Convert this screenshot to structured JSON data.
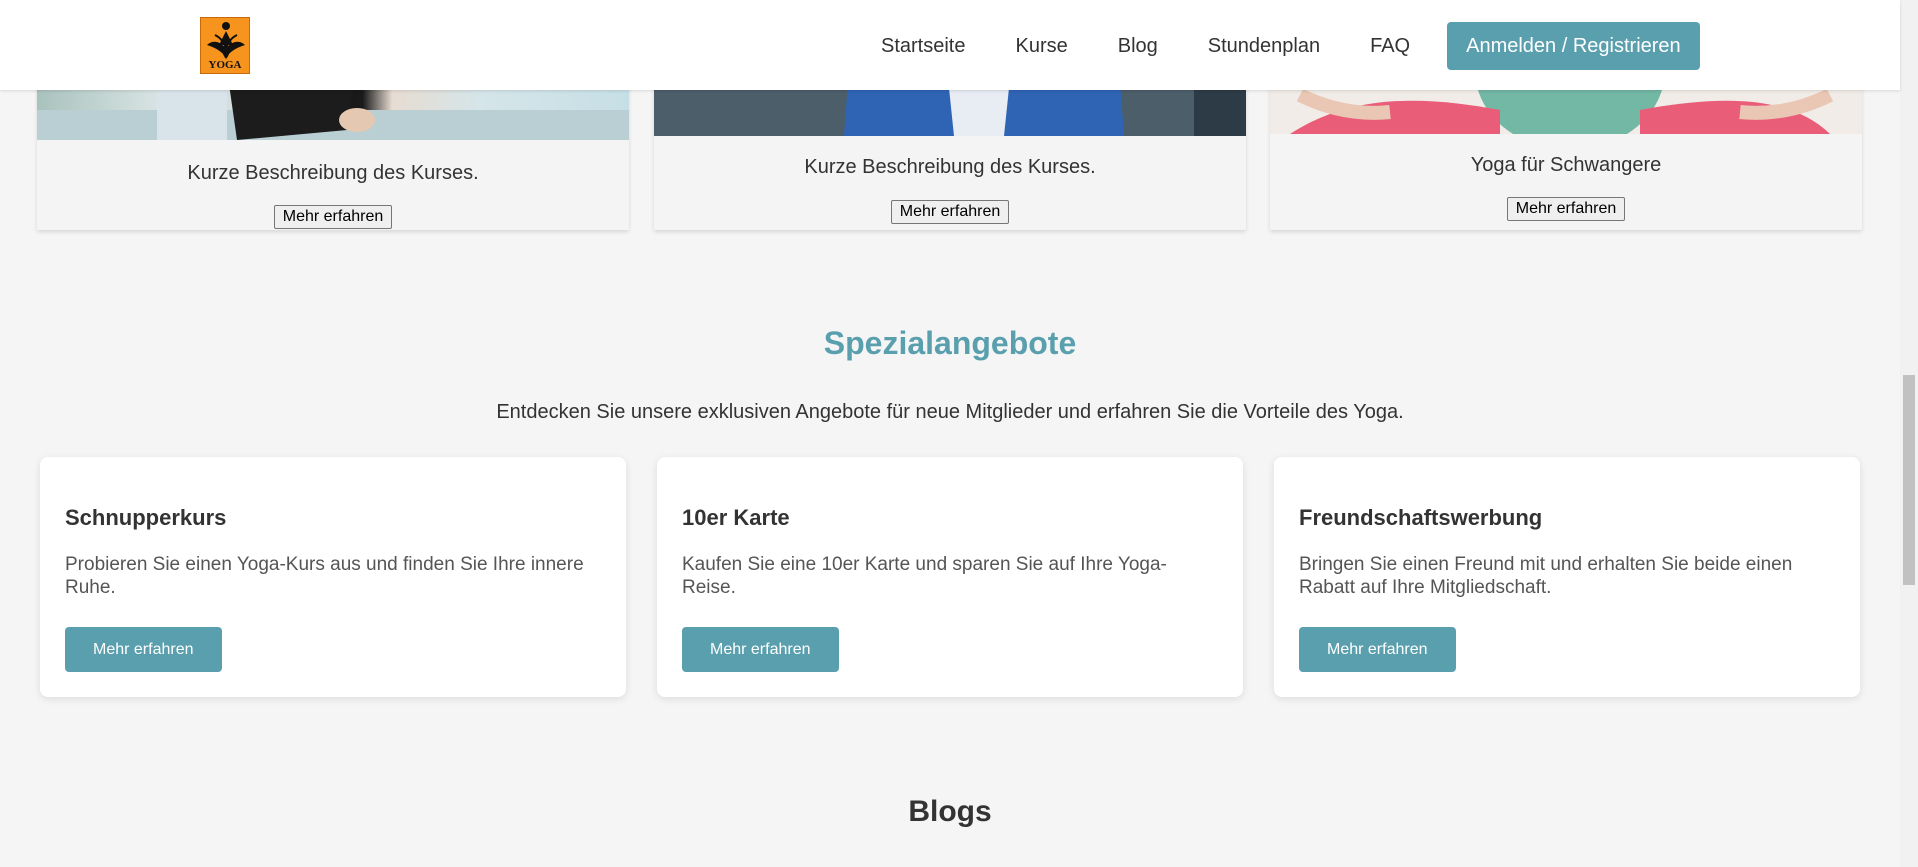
{
  "header": {
    "logo_text": "YOGA",
    "nav": [
      "Startseite",
      "Kurse",
      "Blog",
      "Stundenplan",
      "FAQ"
    ],
    "cta": "Anmelden / Registrieren"
  },
  "courses": [
    {
      "desc": "Kurze Beschreibung des Kurses.",
      "button": "Mehr erfahren"
    },
    {
      "desc": "Kurze Beschreibung des Kurses.",
      "button": "Mehr erfahren"
    },
    {
      "desc": "Yoga für Schwangere",
      "button": "Mehr erfahren"
    }
  ],
  "specials": {
    "title": "Spezialangebote",
    "subtitle": "Entdecken Sie unsere exklusiven Angebote für neue Mitglieder und erfahren Sie die Vorteile des Yoga.",
    "offers": [
      {
        "title": "Schnupperkurs",
        "text": "Probieren Sie einen Yoga-Kurs aus und finden Sie Ihre innere Ruhe.",
        "button": "Mehr erfahren"
      },
      {
        "title": "10er Karte",
        "text": "Kaufen Sie eine 10er Karte und sparen Sie auf Ihre Yoga-Reise.",
        "button": "Mehr erfahren"
      },
      {
        "title": "Freundschaftswerbung",
        "text": "Bringen Sie einen Freund mit und erhalten Sie beide einen Rabatt auf Ihre Mitgliedschaft.",
        "button": "Mehr erfahren"
      }
    ]
  },
  "blogs": {
    "title": "Blogs"
  },
  "colors": {
    "accent": "#5a9fae",
    "logo": "#f7941d",
    "background": "#f5f5f5"
  }
}
